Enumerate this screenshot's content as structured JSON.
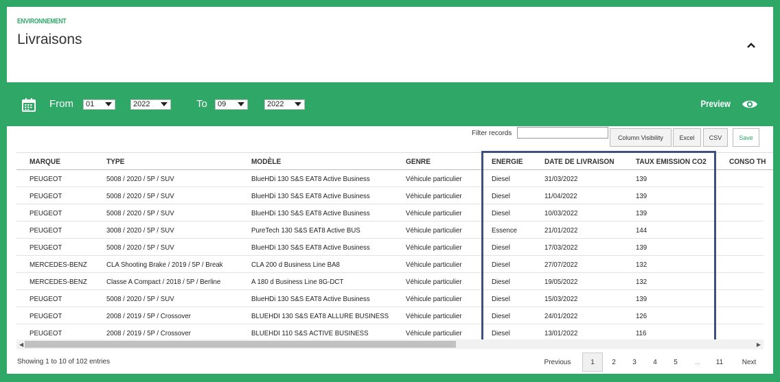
{
  "header": {
    "section_label": "ENVIRONNEMENT",
    "title": "Livraisons"
  },
  "toolbar": {
    "from_label": "From",
    "to_label": "To",
    "from_month": "01",
    "from_year": "2022",
    "to_month": "09",
    "to_year": "2022",
    "preview_label": "Preview"
  },
  "controls": {
    "filter_label": "Filter records",
    "filter_value": "",
    "column_visibility": "Column Visibility",
    "excel": "Excel",
    "csv": "CSV",
    "save": "Save"
  },
  "table": {
    "columns": [
      "MARQUE",
      "TYPE",
      "MODÈLE",
      "GENRE",
      "ENERGIE",
      "DATE DE LIVRAISON",
      "TAUX EMISSION CO2",
      "CONSO TH"
    ],
    "rows": [
      [
        "PEUGEOT",
        "5008 / 2020 / 5P / SUV",
        "BlueHDi 130 S&S EAT8 Active Business",
        "Véhicule particulier",
        "Diesel",
        "31/03/2022",
        "139"
      ],
      [
        "PEUGEOT",
        "5008 / 2020 / 5P / SUV",
        "BlueHDi 130 S&S EAT8 Active Business",
        "Véhicule particulier",
        "Diesel",
        "11/04/2022",
        "139"
      ],
      [
        "PEUGEOT",
        "5008 / 2020 / 5P / SUV",
        "BlueHDi 130 S&S EAT8 Active Business",
        "Véhicule particulier",
        "Diesel",
        "10/03/2022",
        "139"
      ],
      [
        "PEUGEOT",
        "3008 / 2020 / 5P / SUV",
        "PureTech 130 S&S EAT8 Active BUS",
        "Véhicule particulier",
        "Essence",
        "21/01/2022",
        "144"
      ],
      [
        "PEUGEOT",
        "5008 / 2020 / 5P / SUV",
        "BlueHDi 130 S&S EAT8 Active Business",
        "Véhicule particulier",
        "Diesel",
        "17/03/2022",
        "139"
      ],
      [
        "MERCEDES-BENZ",
        "CLA Shooting Brake / 2019 / 5P / Break",
        "CLA 200 d Business Line BA8",
        "Véhicule particulier",
        "Diesel",
        "27/07/2022",
        "132"
      ],
      [
        "MERCEDES-BENZ",
        "Classe A Compact / 2018 / 5P / Berline",
        "A 180 d Business Line 8G-DCT",
        "Véhicule particulier",
        "Diesel",
        "19/05/2022",
        "132"
      ],
      [
        "PEUGEOT",
        "5008 / 2020 / 5P / SUV",
        "BlueHDi 130 S&S EAT8 Active Business",
        "Véhicule particulier",
        "Diesel",
        "15/03/2022",
        "139"
      ],
      [
        "PEUGEOT",
        "2008 / 2019 / 5P / Crossover",
        "BLUEHDI 130 S&S EAT8 ALLURE BUSINESS",
        "Véhicule particulier",
        "Diesel",
        "24/01/2022",
        "126"
      ],
      [
        "PEUGEOT",
        "2008 / 2019 / 5P / Crossover",
        "BLUEHDI 110 S&S ACTIVE BUSINESS",
        "Véhicule particulier",
        "Diesel",
        "13/01/2022",
        "116"
      ]
    ]
  },
  "footer": {
    "info": "Showing 1 to 10 of 102 entries",
    "previous": "Previous",
    "pages": [
      "1",
      "2",
      "3",
      "4",
      "5",
      "...",
      "11"
    ],
    "current_page": "1",
    "next": "Next"
  },
  "icons": {
    "calendar": "calendar-icon",
    "eye": "eye-icon",
    "collapse": "chevron-up-icon",
    "select_caret": "caret-down-icon"
  },
  "colors": {
    "brand_green": "#2ea767",
    "highlight_border": "#3c4f7e"
  }
}
